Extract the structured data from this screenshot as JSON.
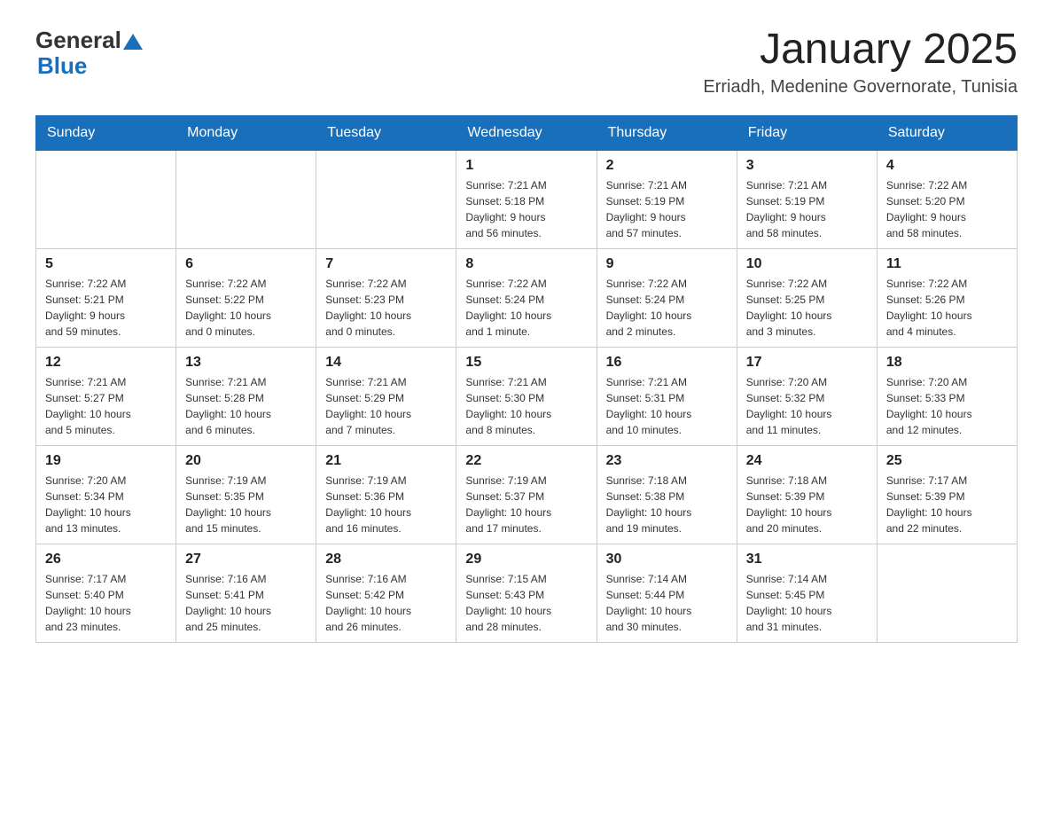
{
  "header": {
    "logo_general": "General",
    "logo_blue": "Blue",
    "month_title": "January 2025",
    "location": "Erriadh, Medenine Governorate, Tunisia"
  },
  "days_of_week": [
    "Sunday",
    "Monday",
    "Tuesday",
    "Wednesday",
    "Thursday",
    "Friday",
    "Saturday"
  ],
  "weeks": [
    [
      {
        "day": "",
        "info": ""
      },
      {
        "day": "",
        "info": ""
      },
      {
        "day": "",
        "info": ""
      },
      {
        "day": "1",
        "info": "Sunrise: 7:21 AM\nSunset: 5:18 PM\nDaylight: 9 hours\nand 56 minutes."
      },
      {
        "day": "2",
        "info": "Sunrise: 7:21 AM\nSunset: 5:19 PM\nDaylight: 9 hours\nand 57 minutes."
      },
      {
        "day": "3",
        "info": "Sunrise: 7:21 AM\nSunset: 5:19 PM\nDaylight: 9 hours\nand 58 minutes."
      },
      {
        "day": "4",
        "info": "Sunrise: 7:22 AM\nSunset: 5:20 PM\nDaylight: 9 hours\nand 58 minutes."
      }
    ],
    [
      {
        "day": "5",
        "info": "Sunrise: 7:22 AM\nSunset: 5:21 PM\nDaylight: 9 hours\nand 59 minutes."
      },
      {
        "day": "6",
        "info": "Sunrise: 7:22 AM\nSunset: 5:22 PM\nDaylight: 10 hours\nand 0 minutes."
      },
      {
        "day": "7",
        "info": "Sunrise: 7:22 AM\nSunset: 5:23 PM\nDaylight: 10 hours\nand 0 minutes."
      },
      {
        "day": "8",
        "info": "Sunrise: 7:22 AM\nSunset: 5:24 PM\nDaylight: 10 hours\nand 1 minute."
      },
      {
        "day": "9",
        "info": "Sunrise: 7:22 AM\nSunset: 5:24 PM\nDaylight: 10 hours\nand 2 minutes."
      },
      {
        "day": "10",
        "info": "Sunrise: 7:22 AM\nSunset: 5:25 PM\nDaylight: 10 hours\nand 3 minutes."
      },
      {
        "day": "11",
        "info": "Sunrise: 7:22 AM\nSunset: 5:26 PM\nDaylight: 10 hours\nand 4 minutes."
      }
    ],
    [
      {
        "day": "12",
        "info": "Sunrise: 7:21 AM\nSunset: 5:27 PM\nDaylight: 10 hours\nand 5 minutes."
      },
      {
        "day": "13",
        "info": "Sunrise: 7:21 AM\nSunset: 5:28 PM\nDaylight: 10 hours\nand 6 minutes."
      },
      {
        "day": "14",
        "info": "Sunrise: 7:21 AM\nSunset: 5:29 PM\nDaylight: 10 hours\nand 7 minutes."
      },
      {
        "day": "15",
        "info": "Sunrise: 7:21 AM\nSunset: 5:30 PM\nDaylight: 10 hours\nand 8 minutes."
      },
      {
        "day": "16",
        "info": "Sunrise: 7:21 AM\nSunset: 5:31 PM\nDaylight: 10 hours\nand 10 minutes."
      },
      {
        "day": "17",
        "info": "Sunrise: 7:20 AM\nSunset: 5:32 PM\nDaylight: 10 hours\nand 11 minutes."
      },
      {
        "day": "18",
        "info": "Sunrise: 7:20 AM\nSunset: 5:33 PM\nDaylight: 10 hours\nand 12 minutes."
      }
    ],
    [
      {
        "day": "19",
        "info": "Sunrise: 7:20 AM\nSunset: 5:34 PM\nDaylight: 10 hours\nand 13 minutes."
      },
      {
        "day": "20",
        "info": "Sunrise: 7:19 AM\nSunset: 5:35 PM\nDaylight: 10 hours\nand 15 minutes."
      },
      {
        "day": "21",
        "info": "Sunrise: 7:19 AM\nSunset: 5:36 PM\nDaylight: 10 hours\nand 16 minutes."
      },
      {
        "day": "22",
        "info": "Sunrise: 7:19 AM\nSunset: 5:37 PM\nDaylight: 10 hours\nand 17 minutes."
      },
      {
        "day": "23",
        "info": "Sunrise: 7:18 AM\nSunset: 5:38 PM\nDaylight: 10 hours\nand 19 minutes."
      },
      {
        "day": "24",
        "info": "Sunrise: 7:18 AM\nSunset: 5:39 PM\nDaylight: 10 hours\nand 20 minutes."
      },
      {
        "day": "25",
        "info": "Sunrise: 7:17 AM\nSunset: 5:39 PM\nDaylight: 10 hours\nand 22 minutes."
      }
    ],
    [
      {
        "day": "26",
        "info": "Sunrise: 7:17 AM\nSunset: 5:40 PM\nDaylight: 10 hours\nand 23 minutes."
      },
      {
        "day": "27",
        "info": "Sunrise: 7:16 AM\nSunset: 5:41 PM\nDaylight: 10 hours\nand 25 minutes."
      },
      {
        "day": "28",
        "info": "Sunrise: 7:16 AM\nSunset: 5:42 PM\nDaylight: 10 hours\nand 26 minutes."
      },
      {
        "day": "29",
        "info": "Sunrise: 7:15 AM\nSunset: 5:43 PM\nDaylight: 10 hours\nand 28 minutes."
      },
      {
        "day": "30",
        "info": "Sunrise: 7:14 AM\nSunset: 5:44 PM\nDaylight: 10 hours\nand 30 minutes."
      },
      {
        "day": "31",
        "info": "Sunrise: 7:14 AM\nSunset: 5:45 PM\nDaylight: 10 hours\nand 31 minutes."
      },
      {
        "day": "",
        "info": ""
      }
    ]
  ]
}
